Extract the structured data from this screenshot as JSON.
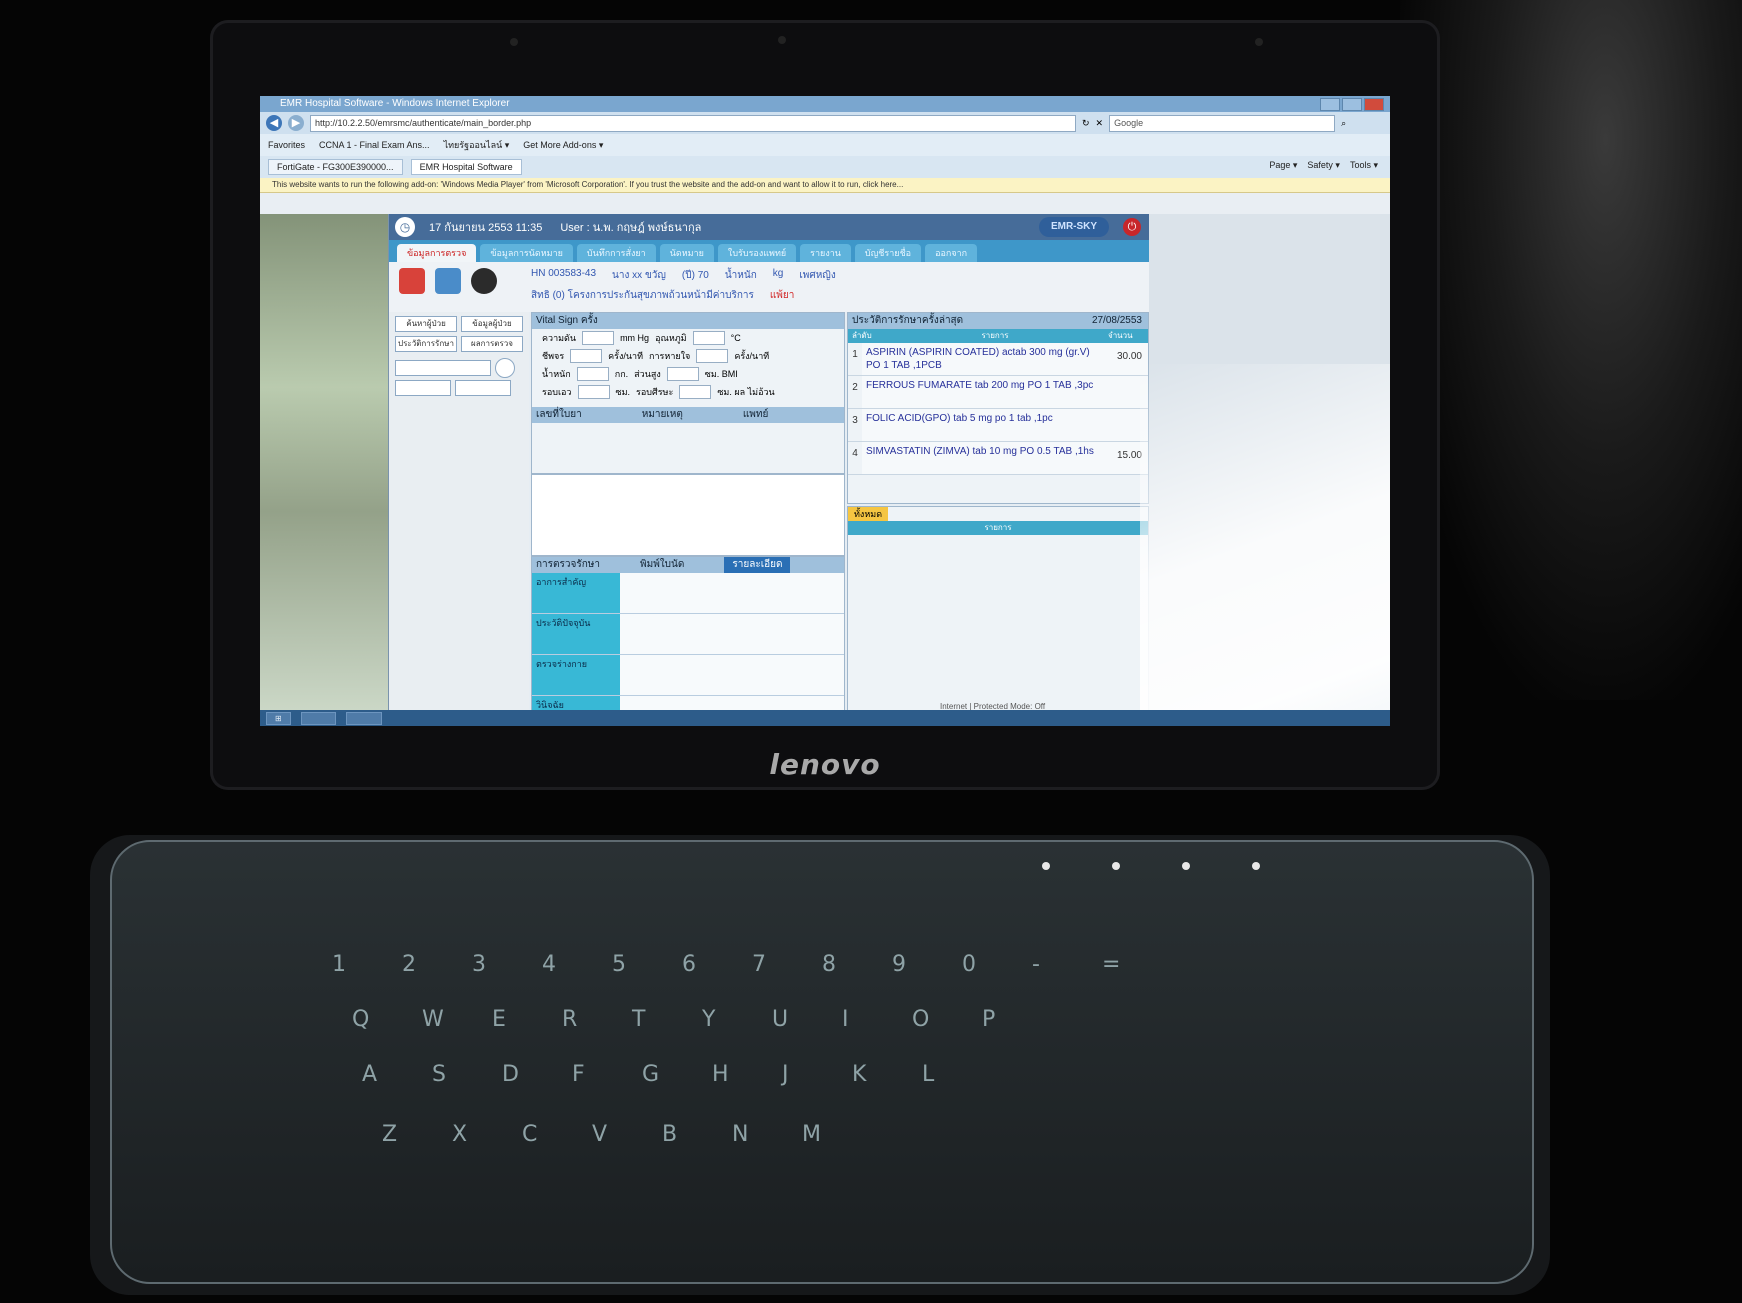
{
  "brand": "lenovo",
  "browser": {
    "title": "EMR Hospital Software - Windows Internet Explorer",
    "url": "http://10.2.2.50/emrsmc/authenticate/main_border.php",
    "search_placeholder": "Google",
    "favorites": [
      "Favorites",
      "CCNA 1 - Final Exam Ans...",
      "ไทยรัฐออนไลน์ ▾",
      "Get More Add-ons ▾"
    ],
    "tabs": [
      "FortiGate - FG300E390000...",
      "EMR Hospital Software"
    ],
    "commands": [
      "Page ▾",
      "Safety ▾",
      "Tools ▾"
    ],
    "infobar": "This website wants to run the following add-on: 'Windows Media Player' from 'Microsoft Corporation'. If you trust the website and the add-on and want to allow it to run, click here...",
    "status": "Internet | Protected Mode: Off"
  },
  "app": {
    "datetime": "17 กันยายน 2553 11:35",
    "user": "User : น.พ. กฤษฎ์ พงษ์ธนากุล",
    "logo": "EMR-SKY",
    "tabs": [
      "ข้อมูลการตรวจ",
      "ข้อมูลการนัดหมาย",
      "บันทึกการสั่งยา",
      "นัดหมาย",
      "ใบรับรองแพทย์",
      "รายงาน",
      "บัญชีรายชื่อ",
      "ออกจาก"
    ],
    "patient": {
      "hn": "HN 003583-43",
      "name": "นาง xx ขวัญ",
      "age": "(ปี) 70",
      "weight_label": "น้ำหนัก",
      "weight_unit": "kg",
      "sex": "เพศหญิง",
      "right": "สิทธิ (0) โครงการประกันสุขภาพถ้วนหน้ามีค่าบริการ",
      "allergy": "แพ้ยา"
    },
    "left_buttons": [
      "ค้นหาผู้ป่วย",
      "ข้อมูลผู้ป่วย",
      "ประวัติการรักษา",
      "ผลการตรวจ"
    ],
    "vital": {
      "title": "Vital Sign",
      "times": "ครั้ง",
      "rows": [
        [
          "ความดัน",
          "mm Hg",
          "อุณหภูมิ",
          "°C"
        ],
        [
          "ชีพจร",
          "ครั้ง/นาที",
          "การหายใจ",
          "ครั้ง/นาที"
        ],
        [
          "น้ำหนัก",
          "กก.",
          "ส่วนสูง",
          "ซม. BMI"
        ],
        [
          "รอบเอว",
          "ซม.",
          "รอบศีรษะ",
          "ซม. ผล ไม่อ้วน"
        ]
      ]
    },
    "diagnosis": {
      "title": "เลขที่ใบยา",
      "col2": "หมายเหตุ",
      "col3": "แพทย์"
    },
    "treatment": {
      "title": "การตรวจรักษา",
      "check": "พิมพ์ใบนัด",
      "button": "รายละเอียด",
      "rows": [
        "อาการสำคัญ",
        "ประวัติปัจจุบัน",
        "ตรวจร่างกาย",
        "วินิจฉัย"
      ]
    },
    "meds": {
      "title": "ประวัติการรักษาครั้งล่าสุด",
      "date": "27/08/2553",
      "headers": [
        "ลำดับ",
        "รายการ",
        "จำนวน"
      ],
      "items": [
        {
          "no": "1",
          "name": "ASPIRIN (ASPIRIN COATED) actab 300 mg (gr.V) PO 1 TAB ,1PCB",
          "qty": "30.00"
        },
        {
          "no": "2",
          "name": "FERROUS FUMARATE tab 200 mg PO 1 TAB ,3pc",
          "qty": ""
        },
        {
          "no": "3",
          "name": "FOLIC ACID(GPO) tab 5 mg po 1 tab ,1pc",
          "qty": ""
        },
        {
          "no": "4",
          "name": "SIMVASTATIN (ZIMVA) tab 10 mg PO 0.5 TAB ,1hs",
          "qty": "15.00"
        }
      ]
    },
    "order": {
      "tab": "ทั้งหมด",
      "header": "รายการ"
    }
  },
  "keyboard": {
    "row1": [
      "1",
      "2",
      "3",
      "4",
      "5",
      "6",
      "7",
      "8",
      "9",
      "0",
      "-",
      "="
    ],
    "row2": [
      "Q",
      "W",
      "E",
      "R",
      "T",
      "Y",
      "U",
      "I",
      "O",
      "P"
    ],
    "row3": [
      "A",
      "S",
      "D",
      "F",
      "G",
      "H",
      "J",
      "K",
      "L"
    ],
    "row4": [
      "Z",
      "X",
      "C",
      "V",
      "B",
      "N",
      "M"
    ]
  }
}
